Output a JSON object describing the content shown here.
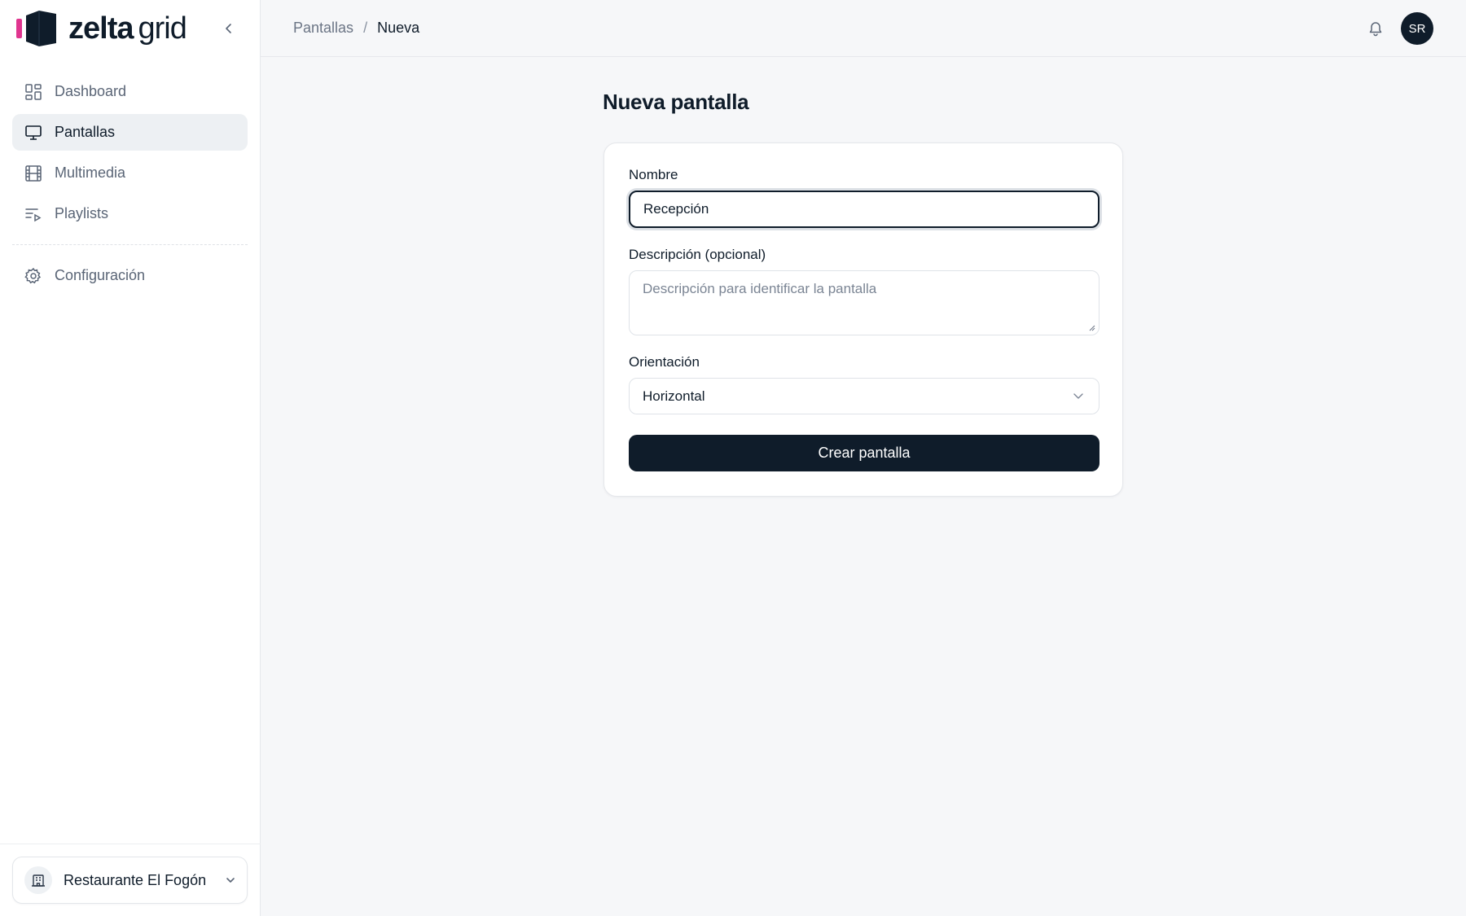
{
  "brand": {
    "name_bold": "zelta",
    "name_light": "grid",
    "accent": "#e0358f",
    "dark": "#0f1c2a"
  },
  "sidebar": {
    "collapse_icon": "chevron-left-icon",
    "items": [
      {
        "label": "Dashboard",
        "icon": "grid-icon",
        "active": false
      },
      {
        "label": "Pantallas",
        "icon": "monitor-icon",
        "active": true
      },
      {
        "label": "Multimedia",
        "icon": "film-icon",
        "active": false
      },
      {
        "label": "Playlists",
        "icon": "playlist-icon",
        "active": false
      }
    ],
    "secondary": [
      {
        "label": "Configuración",
        "icon": "gear-icon"
      }
    ],
    "workspace": {
      "name": "Restaurante El Fogón",
      "icon": "building-icon"
    }
  },
  "header": {
    "breadcrumb": {
      "parent": "Pantallas",
      "separator": "/",
      "current": "Nueva"
    },
    "avatar_initials": "SR",
    "bell_icon": "bell-icon"
  },
  "main": {
    "title": "Nueva pantalla",
    "form": {
      "name_label": "Nombre",
      "name_value": "Recepción",
      "description_label": "Descripción (opcional)",
      "description_placeholder": "Descripción para identificar la pantalla",
      "orientation_label": "Orientación",
      "orientation_value": "Horizontal",
      "submit_label": "Crear pantalla"
    }
  }
}
